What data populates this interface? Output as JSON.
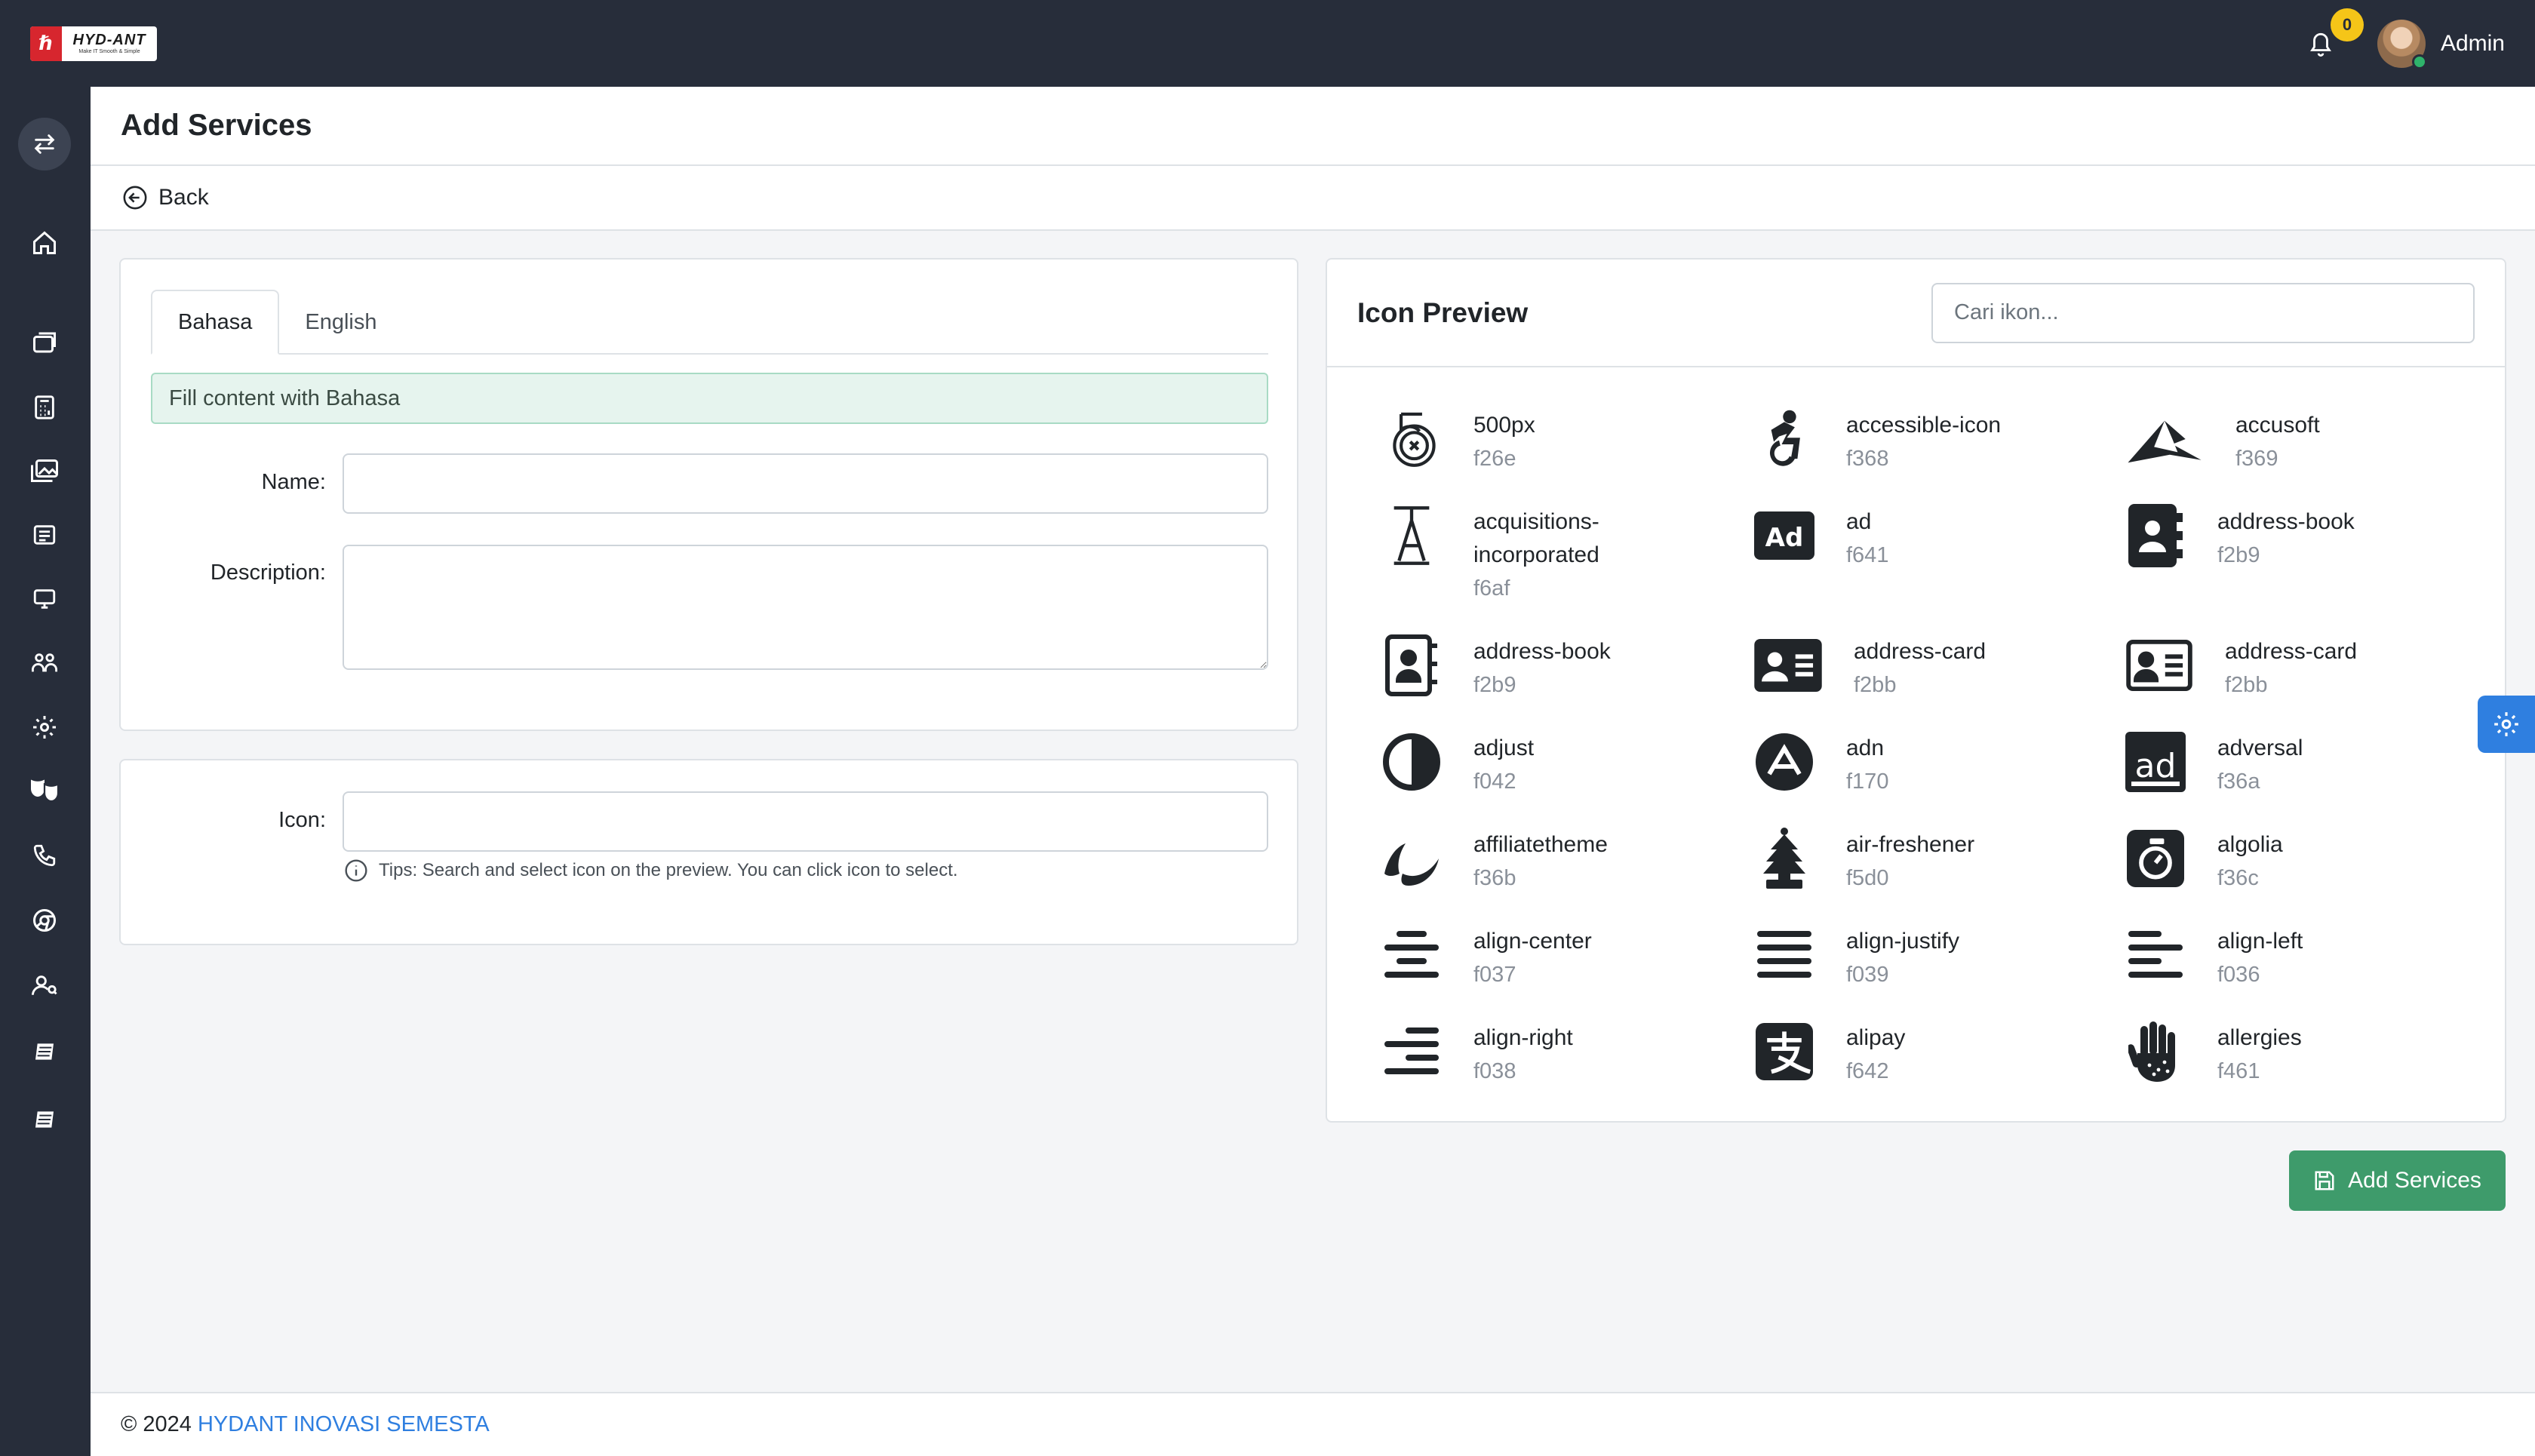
{
  "brand": {
    "logo_text": "HYD-ANT",
    "logo_tagline": "Make IT Smooth & Simple"
  },
  "topbar": {
    "notification_count": "0",
    "user_name": "Admin"
  },
  "sidebar": {
    "items": [
      "toggle-icon",
      "home-icon",
      "window-icon",
      "calculator-icon",
      "gallery-icon",
      "news-icon",
      "monitor-icon",
      "users-icon",
      "gear-icon",
      "masks-icon",
      "phone-icon",
      "chrome-icon",
      "user-search-icon",
      "stack-icon",
      "stack-icon"
    ]
  },
  "header": {
    "title": "Add Services",
    "back_label": "Back"
  },
  "form": {
    "tabs": [
      {
        "label": "Bahasa",
        "active": true
      },
      {
        "label": "English",
        "active": false
      }
    ],
    "alert": "Fill content with Bahasa",
    "name_label": "Name:",
    "name_value": "",
    "description_label": "Description:",
    "description_value": "",
    "icon_label": "Icon:",
    "icon_value": "",
    "tips": "Tips: Search and select icon on the preview. You can click icon to select."
  },
  "preview": {
    "title": "Icon Preview",
    "search_placeholder": "Cari ikon...",
    "icons": [
      {
        "name": "500px",
        "code": "f26e"
      },
      {
        "name": "accessible-icon",
        "code": "f368"
      },
      {
        "name": "accusoft",
        "code": "f369"
      },
      {
        "name": "acquisitions-",
        "name2": "incorporated",
        "code": "f6af"
      },
      {
        "name": "ad",
        "code": "f641"
      },
      {
        "name": "address-book",
        "code": "f2b9"
      },
      {
        "name": "address-book",
        "code": "f2b9"
      },
      {
        "name": "address-card",
        "code": "f2bb"
      },
      {
        "name": "address-card",
        "code": "f2bb"
      },
      {
        "name": "adjust",
        "code": "f042"
      },
      {
        "name": "adn",
        "code": "f170"
      },
      {
        "name": "adversal",
        "code": "f36a"
      },
      {
        "name": "affiliatetheme",
        "code": "f36b"
      },
      {
        "name": "air-freshener",
        "code": "f5d0"
      },
      {
        "name": "algolia",
        "code": "f36c"
      },
      {
        "name": "align-center",
        "code": "f037"
      },
      {
        "name": "align-justify",
        "code": "f039"
      },
      {
        "name": "align-left",
        "code": "f036"
      },
      {
        "name": "align-right",
        "code": "f038"
      },
      {
        "name": "alipay",
        "code": "f642"
      },
      {
        "name": "allergies",
        "code": "f461"
      }
    ]
  },
  "actions": {
    "submit_label": "Add Services"
  },
  "footer": {
    "copyright": "© 2024",
    "company": "HYDANT INOVASI SEMESTA"
  },
  "colors": {
    "dark": "#272d3a",
    "success": "#3e9b6b",
    "link": "#2f7fe0",
    "badge": "#f5c518"
  }
}
